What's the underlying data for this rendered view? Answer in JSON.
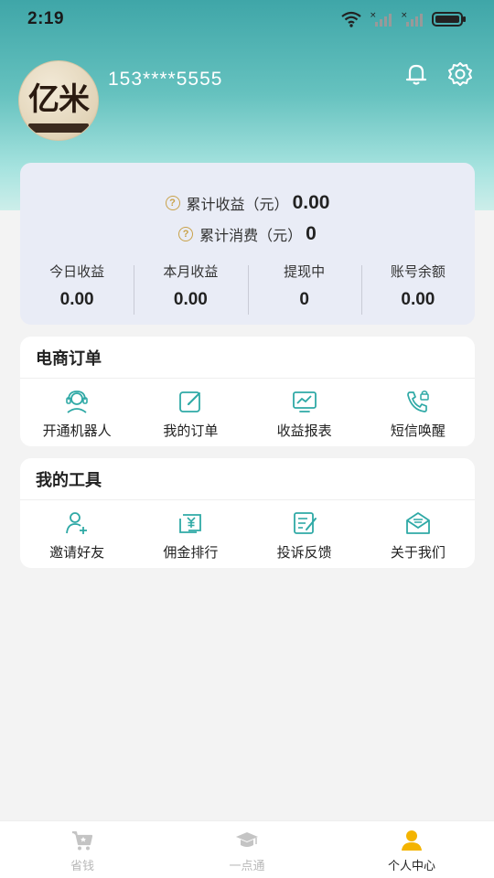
{
  "status_bar": {
    "time": "2:19"
  },
  "profile": {
    "phone": "153****5555",
    "avatar_text": "亿米"
  },
  "summary": {
    "total_income_label": "累计收益（元）",
    "total_income_value": "0.00",
    "total_spend_label": "累计消费（元）",
    "total_spend_value": "0",
    "stats": [
      {
        "label": "今日收益",
        "value": "0.00"
      },
      {
        "label": "本月收益",
        "value": "0.00"
      },
      {
        "label": "提现中",
        "value": "0"
      },
      {
        "label": "账号余额",
        "value": "0.00"
      }
    ]
  },
  "orders_card": {
    "title": "电商订单",
    "items": [
      {
        "label": "开通机器人",
        "icon": "robot-headset-icon"
      },
      {
        "label": "我的订单",
        "icon": "edit-order-icon"
      },
      {
        "label": "收益报表",
        "icon": "chart-monitor-icon"
      },
      {
        "label": "短信唤醒",
        "icon": "phone-lock-icon"
      }
    ]
  },
  "tools_card": {
    "title": "我的工具",
    "items": [
      {
        "label": "邀请好友",
        "icon": "add-user-icon"
      },
      {
        "label": "佣金排行",
        "icon": "yuan-rank-icon"
      },
      {
        "label": "投诉反馈",
        "icon": "feedback-note-icon"
      },
      {
        "label": "关于我们",
        "icon": "envelope-icon"
      }
    ]
  },
  "tabbar": {
    "tabs": [
      {
        "label": "省钱",
        "icon": "cart-icon",
        "active": false
      },
      {
        "label": "一点通",
        "icon": "graduation-cap-icon",
        "active": false
      },
      {
        "label": "个人中心",
        "icon": "person-icon",
        "active": true
      }
    ]
  },
  "colors": {
    "accent": "#2fa9a6",
    "active_tab": "#f4b400",
    "gold": "#c9a24a"
  }
}
